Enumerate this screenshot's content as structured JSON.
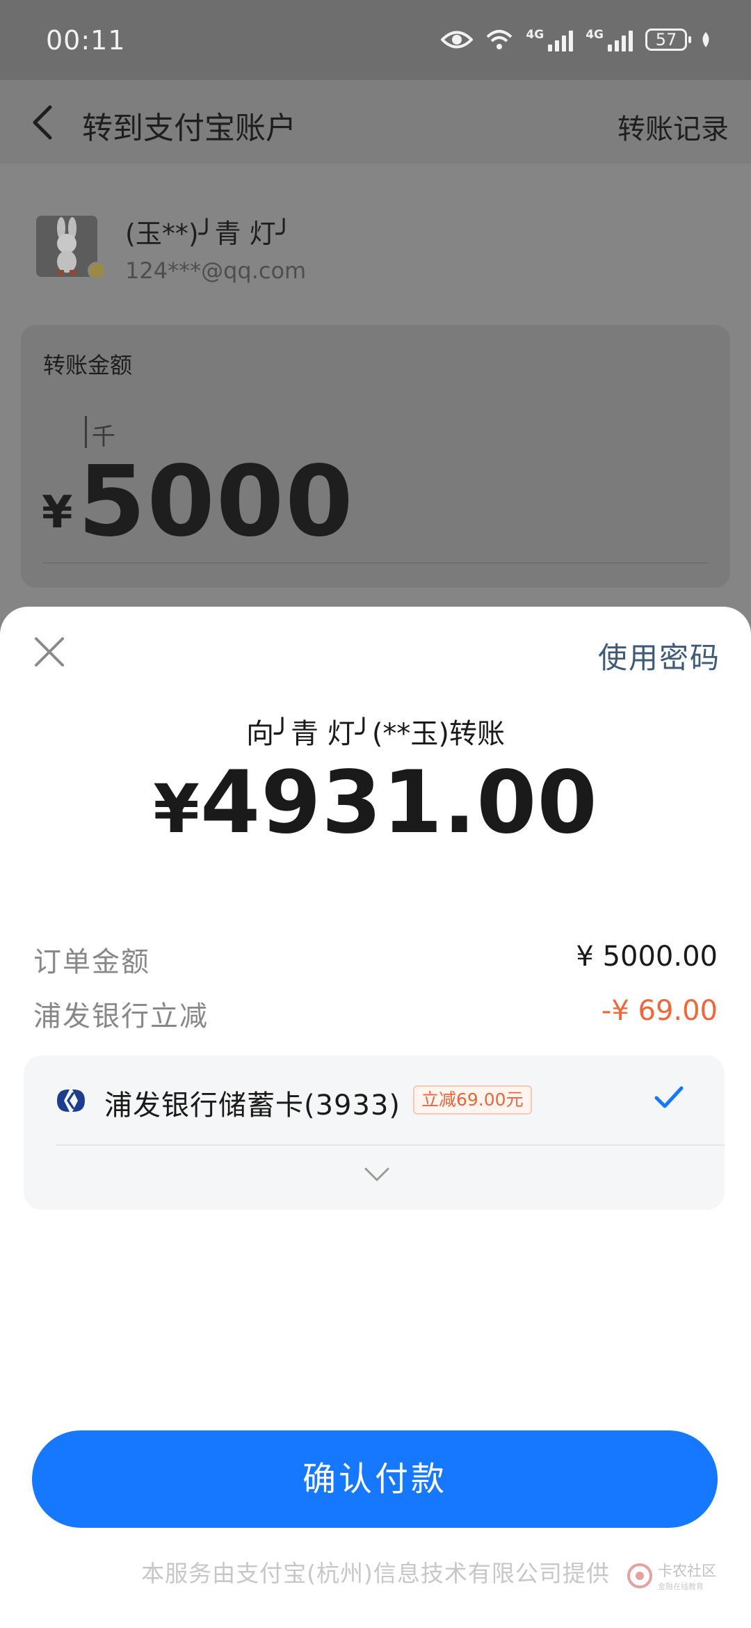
{
  "status_bar": {
    "time": "00:11",
    "network_1": "4G",
    "network_2": "4G",
    "battery": "57"
  },
  "navbar": {
    "title": "转到支付宝账户",
    "right_link": "转账记录"
  },
  "recipient": {
    "name": "(玉**)╯青 灯╯",
    "account": "124***@qq.com"
  },
  "amount_card": {
    "label": "转账金额",
    "unit_hint": "千",
    "currency": "¥",
    "value": "5000"
  },
  "sheet": {
    "use_password": "使用密码",
    "pay_to": "向╯青 灯╯(**玉)转账",
    "currency": "¥",
    "pay_amount": "4931.00",
    "order_label": "订单金额",
    "order_value": "¥ 5000.00",
    "discount_label": "浦发银行立减",
    "discount_value": "-¥ 69.00",
    "payment_method": {
      "bank_name": "浦发银行储蓄卡(3933)",
      "tag": "立减69.00元"
    },
    "confirm_label": "确认付款",
    "footer": "本服务由支付宝(杭州)信息技术有限公司提供"
  },
  "watermark": {
    "name": "卡农社区",
    "sub": "金融在线教育"
  },
  "colors": {
    "primary": "#1677ff",
    "discount": "#f0683a",
    "link": "#3f5a78"
  }
}
